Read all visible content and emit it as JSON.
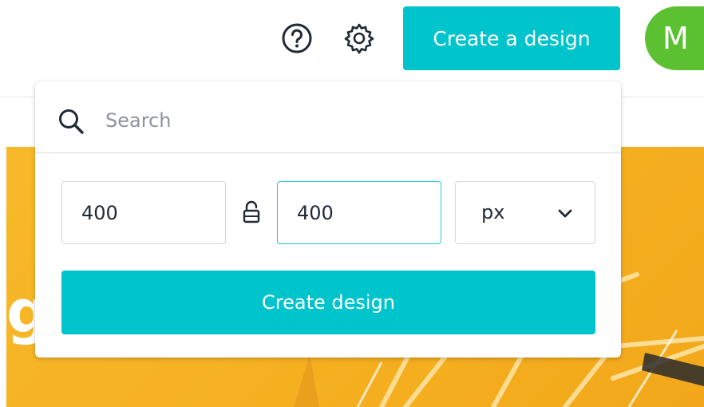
{
  "header": {
    "help_icon": "question-circle-icon",
    "settings_icon": "gear-icon",
    "create_button_label": "Create a design",
    "avatar_initial": "M",
    "avatar_color": "#5cc130",
    "accent_color": "#00c4cc"
  },
  "hero": {
    "visible_text": "g.",
    "background_color": "#f5b020"
  },
  "popover": {
    "search": {
      "icon": "search-icon",
      "placeholder": "Search",
      "value": ""
    },
    "dimensions": {
      "width_value": "400",
      "height_value": "400",
      "lock_icon": "unlocked-padlock-icon",
      "unit_value": "px",
      "unit_chevron_icon": "chevron-down-icon"
    },
    "create_button_label": "Create design"
  }
}
